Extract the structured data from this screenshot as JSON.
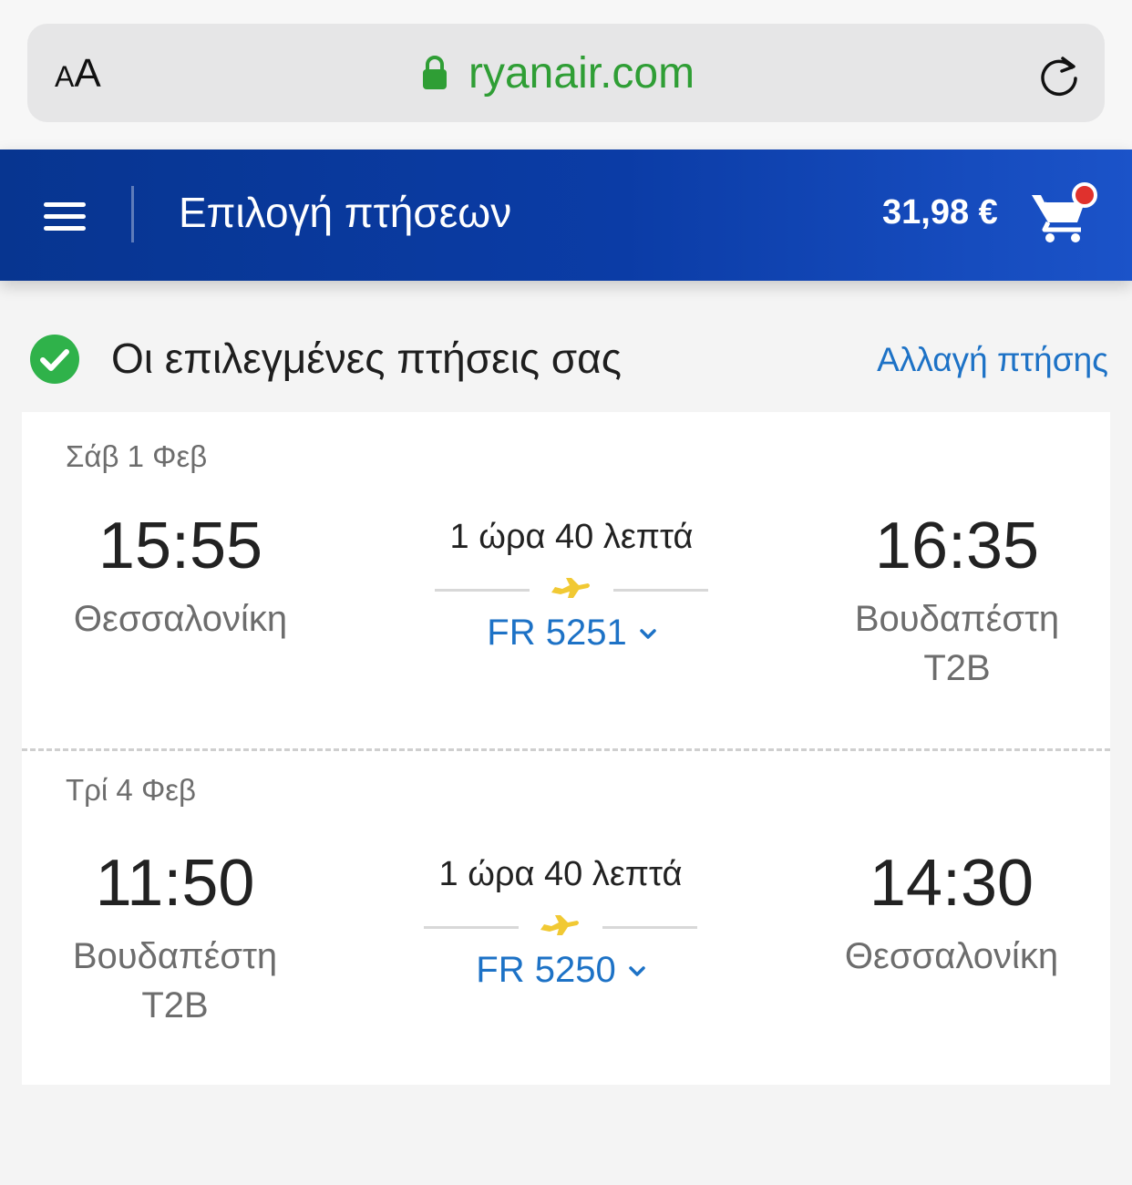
{
  "browser": {
    "text_size_label_small": "A",
    "text_size_label_large": "A",
    "url": "ryanair.com",
    "icons": [
      "lock-icon",
      "reload-icon"
    ]
  },
  "header": {
    "title": "Επιλογή πτήσεων",
    "cart_total": "31,98 €",
    "icons": [
      "menu-icon",
      "cart-icon"
    ]
  },
  "colors": {
    "header_blue": "#073590",
    "link_blue": "#1d72c6",
    "success_green": "#2fb24a",
    "plane_yellow": "#f1c933",
    "url_green": "#2f9e35",
    "badge_red": "#e0312d"
  },
  "selected": {
    "title": "Οι επιλεγμένες πτήσεις σας",
    "change_link": "Αλλαγή πτήσης"
  },
  "legs": [
    {
      "date": "Σάβ 1 Φεβ",
      "departure_time": "15:55",
      "departure_city": "Θεσσαλονίκη",
      "duration": "1 ώρα 40 λεπτά",
      "flight_number": "FR 5251",
      "arrival_time": "16:35",
      "arrival_city": "Βουδαπέστη T2B"
    },
    {
      "date": "Τρί 4 Φεβ",
      "departure_time": "11:50",
      "departure_city": "Βουδαπέστη T2B",
      "duration": "1 ώρα 40 λεπτά",
      "flight_number": "FR 5250",
      "arrival_time": "14:30",
      "arrival_city": "Θεσσαλονίκη"
    }
  ]
}
